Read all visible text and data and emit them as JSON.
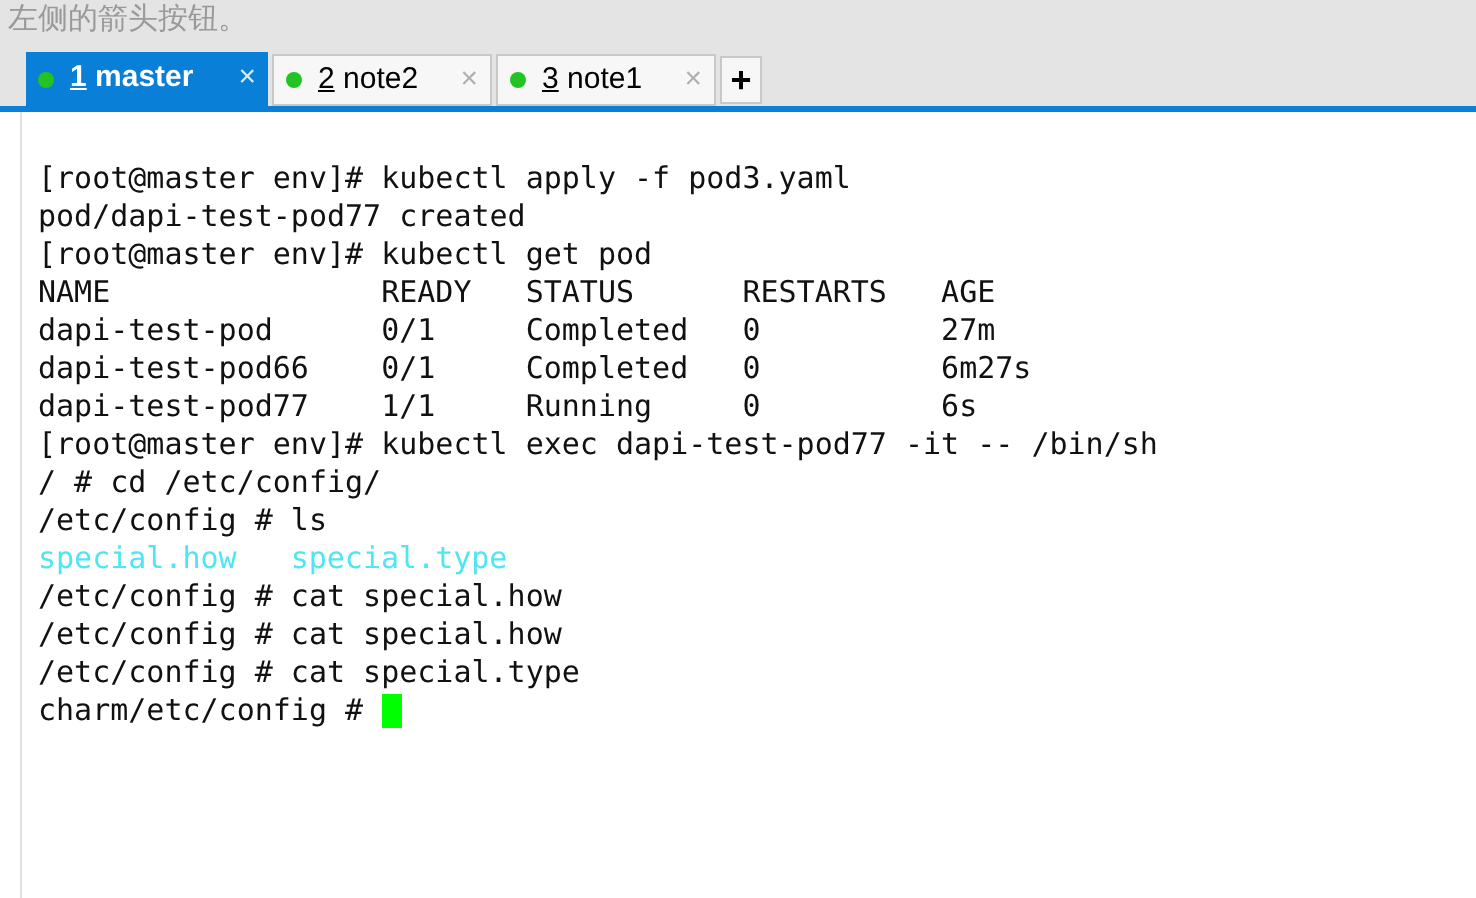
{
  "hint": "左侧的箭头按钮。",
  "tabs": [
    {
      "number": "1",
      "name": "master",
      "selected": true,
      "close": "×"
    },
    {
      "number": "2",
      "name": "note2",
      "selected": false,
      "close": "×"
    },
    {
      "number": "3",
      "name": "note1",
      "selected": false,
      "close": "×"
    }
  ],
  "new_tab": "+",
  "terminal": [
    {
      "kind": "text",
      "text": "[root@master env]# kubectl apply -f pod3.yaml"
    },
    {
      "kind": "text",
      "text": "pod/dapi-test-pod77 created"
    },
    {
      "kind": "text",
      "text": "[root@master env]# kubectl get pod"
    },
    {
      "kind": "text",
      "text": "NAME               READY   STATUS      RESTARTS   AGE"
    },
    {
      "kind": "text",
      "text": "dapi-test-pod      0/1     Completed   0          27m"
    },
    {
      "kind": "text",
      "text": "dapi-test-pod66    0/1     Completed   0          6m27s"
    },
    {
      "kind": "text",
      "text": "dapi-test-pod77    1/1     Running     0          6s"
    },
    {
      "kind": "text",
      "text": "[root@master env]# kubectl exec dapi-test-pod77 -it -- /bin/sh"
    },
    {
      "kind": "text",
      "text": "/ # cd /etc/config/"
    },
    {
      "kind": "text",
      "text": "/etc/config # ls"
    },
    {
      "kind": "listing",
      "items": [
        "special.how",
        "special.type"
      ]
    },
    {
      "kind": "text",
      "text": "/etc/config # cat special.how"
    },
    {
      "kind": "text",
      "text": "/etc/config # cat special.how"
    },
    {
      "kind": "text",
      "text": "/etc/config # cat special.type"
    },
    {
      "kind": "prompt",
      "text": "charm/etc/config # "
    }
  ]
}
